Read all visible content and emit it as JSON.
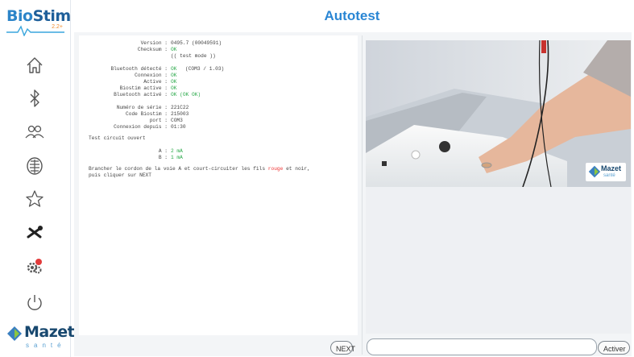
{
  "app": {
    "title": "Autotest",
    "logo": {
      "brand1": "Bio",
      "brand2": "Stim",
      "version": "2.2+"
    },
    "company_logo": {
      "name": "Mazet",
      "sub": "santé"
    }
  },
  "sidebar": {
    "items": [
      {
        "icon": "home-icon"
      },
      {
        "icon": "bluetooth-icon"
      },
      {
        "icon": "users-icon"
      },
      {
        "icon": "anatomy-icon"
      },
      {
        "icon": "star-icon"
      },
      {
        "icon": "tools-icon"
      },
      {
        "icon": "settings-icon"
      },
      {
        "icon": "power-icon"
      }
    ]
  },
  "console": {
    "version_key": "Version :",
    "version_val": "0495.7 (00049591)",
    "checksum_key": "Checksum :",
    "checksum_val": "OK",
    "test_mode": "(( test mode ))",
    "bluetooth_key": "Bluetooth détecté :",
    "bluetooth_val": "OK",
    "bluetooth_com": "(COM3 / 1.03)",
    "connexion_key": "Connexion :",
    "connexion_val": "OK",
    "active_key": "Active :",
    "active_val": "OK",
    "biostim_key": "Biostim active :",
    "biostim_val": "OK",
    "bt_active_key": "Bluetooth activé :",
    "bt_active_val": "OK (OK OK)",
    "serial_key": "Numéro de série :",
    "serial_val": "221C22",
    "code_key": "Code Biostim :",
    "code_val": "215003",
    "port_key": "port :",
    "port_val": "COM3",
    "boot_key": "Connexion depuis :",
    "boot_val": "01:30",
    "test_circuit": "Test circuit ouvert",
    "a_key": "A :",
    "a_val": "2 mA",
    "b_key": "B :",
    "b_val": "1 mA",
    "instruction_1": "Brancher le cordon de la voie A et court-circuiter les fils",
    "instruction_red": "rouge",
    "instruction_2": "et noir,",
    "instruction_3": "puis cliquer sur NEXT"
  },
  "buttons": {
    "next": "NEXT",
    "activer": "Activer"
  },
  "input": {
    "value": ""
  },
  "colors": {
    "accent": "#2a86d4",
    "ok_green": "#28a848",
    "red": "#e33333",
    "panel_bg": "#f3f5f7"
  }
}
